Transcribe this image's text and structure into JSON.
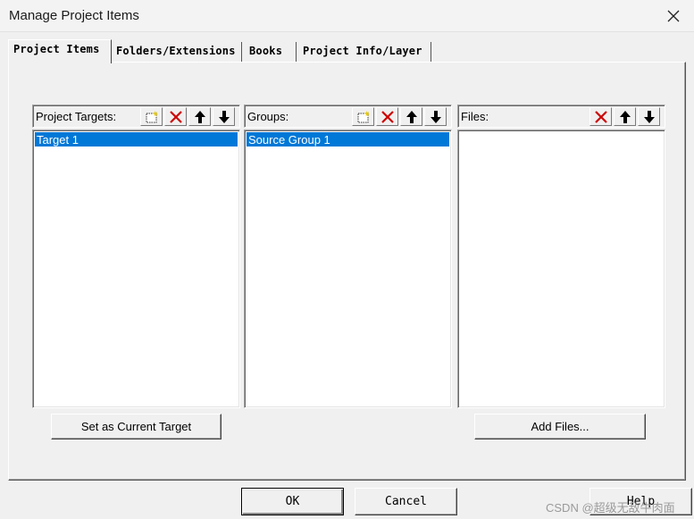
{
  "window": {
    "title": "Manage Project Items"
  },
  "tabs": [
    {
      "label": "Project Items",
      "active": true
    },
    {
      "label": "Folders/Extensions",
      "active": false
    },
    {
      "label": "Books",
      "active": false
    },
    {
      "label": "Project Info/Layer",
      "active": false
    }
  ],
  "panels": {
    "targets": {
      "label": "Project Targets:",
      "items": [
        "Target 1"
      ],
      "selected": "Target 1"
    },
    "groups": {
      "label": "Groups:",
      "items": [
        "Source Group 1"
      ],
      "selected": "Source Group 1"
    },
    "files": {
      "label": "Files:",
      "items": []
    }
  },
  "buttons": {
    "set_current_target": "Set as Current Target",
    "add_files": "Add Files...",
    "ok": "OK",
    "cancel": "Cancel",
    "help": "Help"
  },
  "watermark": "CSDN @超级无敌牛肉面",
  "colors": {
    "selection": "#0078d7",
    "delete_icon": "#cc0000",
    "new_icon_sparkle": "#e8c800"
  }
}
